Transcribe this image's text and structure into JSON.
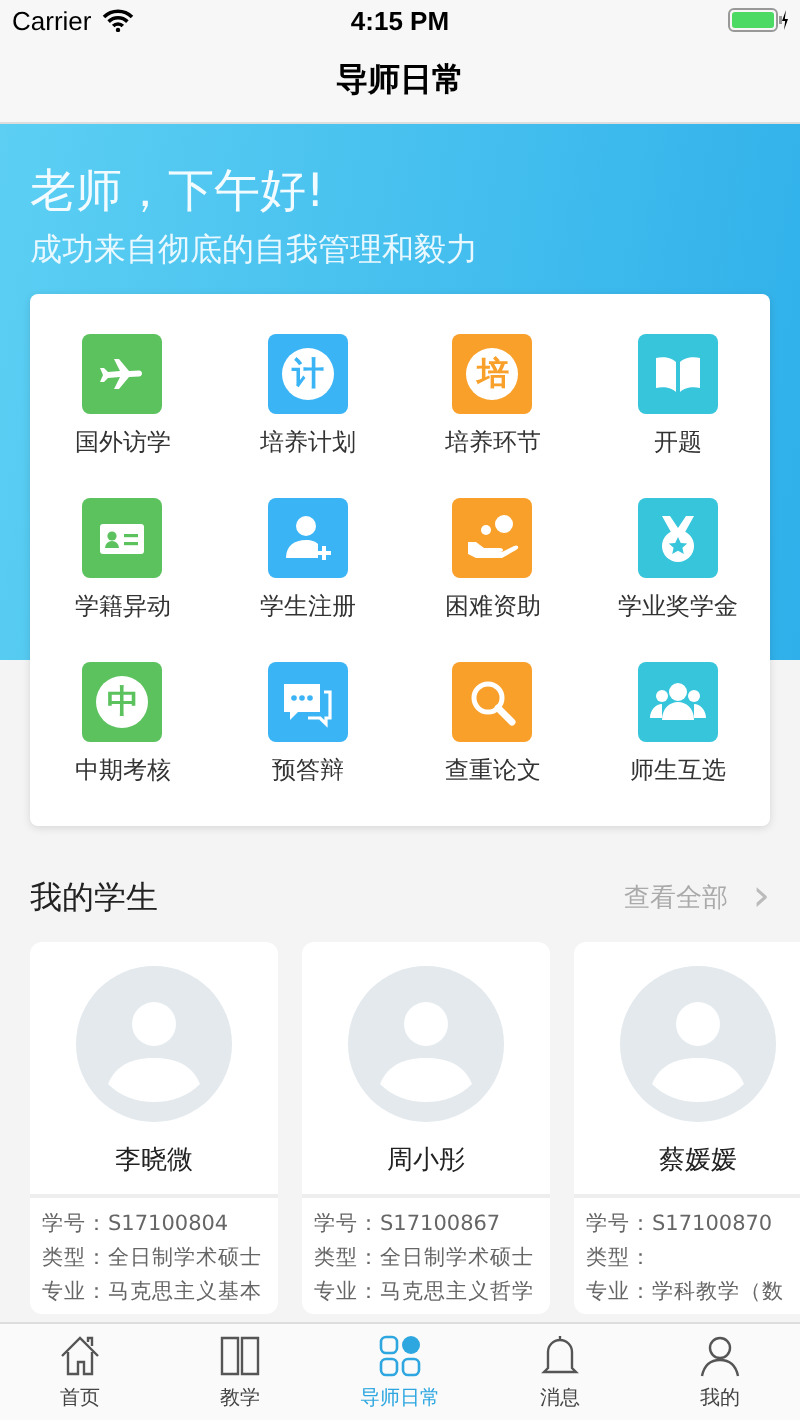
{
  "status_bar": {
    "carrier": "Carrier",
    "time": "4:15 PM"
  },
  "nav": {
    "title": "导师日常"
  },
  "banner": {
    "greeting": "老师，下午好!",
    "motto": "成功来自彻底的自我管理和毅力"
  },
  "features": [
    {
      "label": "国外访学",
      "kind": "plane",
      "color": "#5cc25e"
    },
    {
      "label": "培养计划",
      "kind": "glyph",
      "glyph": "计",
      "color": "#3bb4f5"
    },
    {
      "label": "培养环节",
      "kind": "glyph",
      "glyph": "培",
      "color": "#f9a02a"
    },
    {
      "label": "开题",
      "kind": "book",
      "color": "#37c5dc"
    },
    {
      "label": "学籍异动",
      "kind": "card",
      "color": "#5cc25e"
    },
    {
      "label": "学生注册",
      "kind": "adduser",
      "color": "#3bb4f5"
    },
    {
      "label": "困难资助",
      "kind": "aid",
      "color": "#f9a02a"
    },
    {
      "label": "学业奖学金",
      "kind": "medal",
      "color": "#37c5dc"
    },
    {
      "label": "中期考核",
      "kind": "glyph",
      "glyph": "中",
      "color": "#5cc25e"
    },
    {
      "label": "预答辩",
      "kind": "chat",
      "color": "#3bb4f5"
    },
    {
      "label": "查重论文",
      "kind": "search",
      "color": "#f9a02a"
    },
    {
      "label": "师生互选",
      "kind": "group",
      "color": "#37c5dc"
    }
  ],
  "students_section": {
    "title": "我的学生",
    "view_all": "查看全部",
    "chevron": "›"
  },
  "students": [
    {
      "name": "李晓微",
      "lines": [
        "学号：S17100804",
        "类型：全日制学术硕士",
        "专业：马克思主义基本"
      ]
    },
    {
      "name": "周小彤",
      "lines": [
        "学号：S17100867",
        "类型：全日制学术硕士",
        "专业：马克思主义哲学"
      ]
    },
    {
      "name": "蔡媛媛",
      "lines": [
        "学号：S17100870",
        "类型：",
        "专业：学科教学（数"
      ]
    }
  ],
  "tabs": [
    {
      "label": "首页",
      "kind": "home",
      "selected": false
    },
    {
      "label": "教学",
      "kind": "book",
      "selected": false
    },
    {
      "label": "导师日常",
      "kind": "grid",
      "selected": true
    },
    {
      "label": "消息",
      "kind": "bell",
      "selected": false
    },
    {
      "label": "我的",
      "kind": "person",
      "selected": false
    }
  ]
}
